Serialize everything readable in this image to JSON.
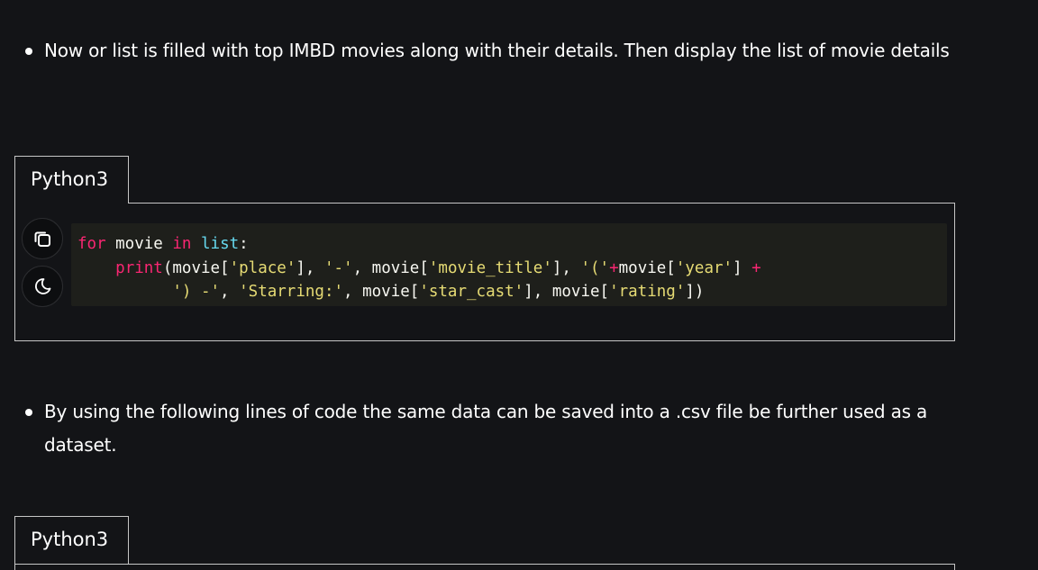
{
  "bullets": [
    {
      "text": "Now or list is filled with top IMBD movies along with their details. Then display the list of movie details"
    },
    {
      "text": "By using the following lines of code the same data can be saved into a .csv file be further used as a dataset."
    }
  ],
  "code_blocks": [
    {
      "tab_label": "Python3",
      "lines": [
        [
          {
            "t": "for",
            "c": "kw"
          },
          {
            "t": " movie ",
            "c": ""
          },
          {
            "t": "in",
            "c": "kw"
          },
          {
            "t": " ",
            "c": ""
          },
          {
            "t": "list",
            "c": "bi"
          },
          {
            "t": ":",
            "c": ""
          }
        ],
        [
          {
            "t": "    ",
            "c": ""
          },
          {
            "t": "print",
            "c": "kw"
          },
          {
            "t": "(movie[",
            "c": ""
          },
          {
            "t": "'place'",
            "c": "str"
          },
          {
            "t": "], ",
            "c": ""
          },
          {
            "t": "'-'",
            "c": "str"
          },
          {
            "t": ", movie[",
            "c": ""
          },
          {
            "t": "'movie_title'",
            "c": "str"
          },
          {
            "t": "], ",
            "c": ""
          },
          {
            "t": "'('",
            "c": "str"
          },
          {
            "t": "+",
            "c": "kw"
          },
          {
            "t": "movie[",
            "c": ""
          },
          {
            "t": "'year'",
            "c": "str"
          },
          {
            "t": "] ",
            "c": ""
          },
          {
            "t": "+",
            "c": "kw"
          }
        ],
        [
          {
            "t": "          ",
            "c": ""
          },
          {
            "t": "') -'",
            "c": "str"
          },
          {
            "t": ", ",
            "c": ""
          },
          {
            "t": "'Starring:'",
            "c": "str"
          },
          {
            "t": ", movie[",
            "c": ""
          },
          {
            "t": "'star_cast'",
            "c": "str"
          },
          {
            "t": "], movie[",
            "c": ""
          },
          {
            "t": "'rating'",
            "c": "str"
          },
          {
            "t": "])",
            "c": ""
          }
        ]
      ],
      "buttons": [
        {
          "icon": "copy-icon"
        },
        {
          "icon": "moon-icon"
        }
      ]
    },
    {
      "tab_label": "Python3"
    }
  ],
  "colors": {
    "background": "#131417",
    "code_background": "#1e1f1b",
    "keyword": "#f92672",
    "builtin": "#66d9ef",
    "string": "#e6db74",
    "border": "#c6c6c6"
  }
}
